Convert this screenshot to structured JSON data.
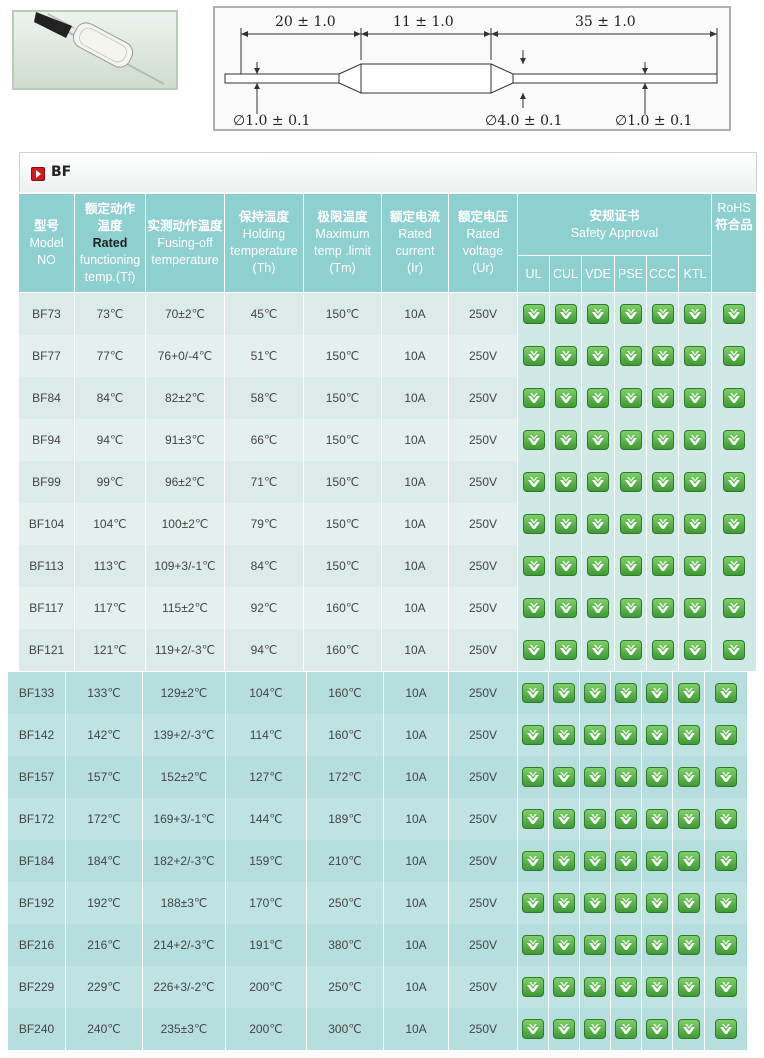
{
  "diagram": {
    "dim_left": "20 ± 1.0",
    "dim_mid": "11 ± 1.0",
    "dim_right": "35 ± 1.0",
    "dia_left": "∅1.0 ± 0.1",
    "dia_mid": "∅4.0 ± 0.1",
    "dia_right": "∅1.0 ± 0.1"
  },
  "section_title": "BF",
  "headers": {
    "model": {
      "zh": "型号",
      "en1": "Model",
      "en2": "NO"
    },
    "rated": {
      "zh": "额定动作温度",
      "bold": "Rated",
      "en1": "functioning",
      "en2": "temp.(Tf)"
    },
    "fusing": {
      "zh": "实测动作温度",
      "en1": "Fusing-off",
      "en2": "temperature"
    },
    "holding": {
      "zh": "保持温度",
      "en1": "Holding",
      "en2": "temperature",
      "en3": "(Th)"
    },
    "max": {
      "zh": "极限温度",
      "en1": "Maximum",
      "en2": "temp .limit",
      "en3": "(Tm)"
    },
    "current": {
      "zh": "额定电流",
      "en1": "Rated",
      "en2": "current",
      "en3": "(Ir)"
    },
    "voltage": {
      "zh": "额定电压",
      "en1": "Rated",
      "en2": "voltage",
      "en3": "(Ur)"
    },
    "safety": {
      "zh": "安规证书",
      "en": "Safety Approval"
    },
    "rohs": {
      "en": "RoHS",
      "zh": "符合品"
    },
    "certs": [
      "UL",
      "CUL",
      "VDE",
      "PSE",
      "CCC",
      "KTL"
    ]
  },
  "check_icon": "check-badge-icon",
  "check_color": "#4aa83e",
  "rows": [
    [
      "BF73",
      "73℃",
      "70±2℃",
      "45℃",
      "150℃",
      "10A",
      "250V"
    ],
    [
      "BF77",
      "77℃",
      "76+0/-4℃",
      "51℃",
      "150℃",
      "10A",
      "250V"
    ],
    [
      "BF84",
      "84℃",
      "82±2℃",
      "58℃",
      "150℃",
      "10A",
      "250V"
    ],
    [
      "BF94",
      "94℃",
      "91±3℃",
      "66℃",
      "150℃",
      "10A",
      "250V"
    ],
    [
      "BF99",
      "99℃",
      "96±2℃",
      "71℃",
      "150℃",
      "10A",
      "250V"
    ],
    [
      "BF104",
      "104℃",
      "100±2℃",
      "79℃",
      "150℃",
      "10A",
      "250V"
    ],
    [
      "BF113",
      "113℃",
      "109+3/-1℃",
      "84℃",
      "150℃",
      "10A",
      "250V"
    ],
    [
      "BF117",
      "117℃",
      "115±2℃",
      "92℃",
      "160℃",
      "10A",
      "250V"
    ],
    [
      "BF121",
      "121℃",
      "119+2/-3℃",
      "94℃",
      "160℃",
      "10A",
      "250V"
    ],
    [
      "BF133",
      "133℃",
      "129±2℃",
      "104℃",
      "160℃",
      "10A",
      "250V"
    ],
    [
      "BF142",
      "142℃",
      "139+2/-3℃",
      "114℃",
      "160℃",
      "10A",
      "250V"
    ],
    [
      "BF157",
      "157℃",
      "152±2℃",
      "127℃",
      "172℃",
      "10A",
      "250V"
    ],
    [
      "BF172",
      "172℃",
      "169+3/-1℃",
      "144℃",
      "189℃",
      "10A",
      "250V"
    ],
    [
      "BF184",
      "184℃",
      "182+2/-3℃",
      "159℃",
      "210℃",
      "10A",
      "250V"
    ],
    [
      "BF192",
      "192℃",
      "188±3℃",
      "170℃",
      "250℃",
      "10A",
      "250V"
    ],
    [
      "BF216",
      "216℃",
      "214+2/-3℃",
      "191℃",
      "380℃",
      "10A",
      "250V"
    ],
    [
      "BF229",
      "229℃",
      "226+3/-2℃",
      "200℃",
      "250℃",
      "10A",
      "250V"
    ],
    [
      "BF240",
      "240℃",
      "235±3℃",
      "200℃",
      "300℃",
      "10A",
      "250V"
    ]
  ]
}
